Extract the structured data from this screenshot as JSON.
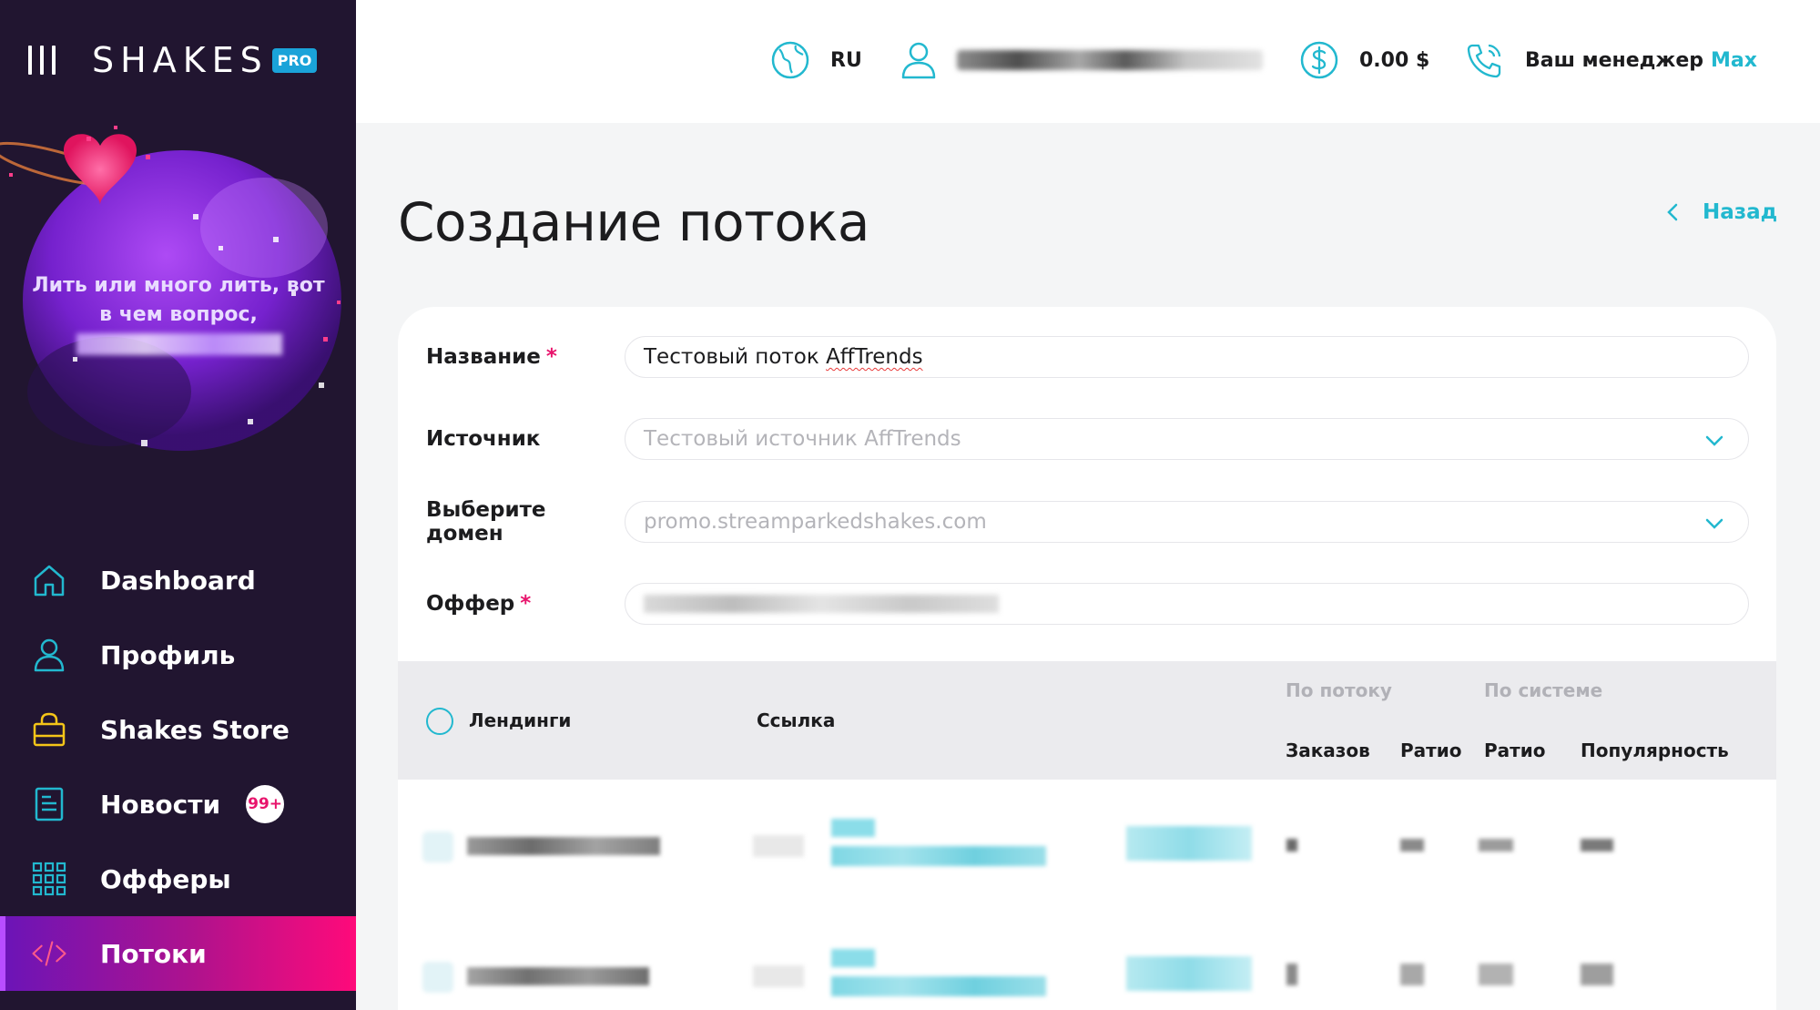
{
  "app": {
    "logo": "SHAKES",
    "logo_badge": "PRO"
  },
  "promo": {
    "text": "Лить или много лить, вот в чем вопрос,"
  },
  "sidebar": {
    "items": [
      {
        "label": "Dashboard",
        "icon": "home-icon"
      },
      {
        "label": "Профиль",
        "icon": "user-icon"
      },
      {
        "label": "Shakes Store",
        "icon": "shopping-bag-icon"
      },
      {
        "label": "Новости",
        "icon": "news-icon",
        "badge": "99+"
      },
      {
        "label": "Офферы",
        "icon": "grid-icon"
      },
      {
        "label": "Потоки",
        "icon": "code-icon",
        "active": true
      }
    ]
  },
  "header": {
    "language": "RU",
    "balance": "0.00 $",
    "manager_label": "Ваш менеджер",
    "manager_name": "Max"
  },
  "page": {
    "title": "Создание потока",
    "back_label": "Назад"
  },
  "form": {
    "name": {
      "label": "Название",
      "value": "Тестовый поток AffTrends",
      "value_plain": "Тестовый поток ",
      "value_flagged": "AffTrends"
    },
    "source": {
      "label": "Источник",
      "placeholder": "Тестовый источник AffTrends"
    },
    "domain": {
      "label": "Выберите домен",
      "placeholder": "promo.streamparkedshakes.com"
    },
    "offer": {
      "label": "Оффер"
    },
    "required_mark": "*"
  },
  "table": {
    "col_landings": "Лендинги",
    "col_link": "Ссылка",
    "group_stream": "По потоку",
    "group_system": "По системе",
    "col_orders": "Заказов",
    "col_ratio_stream": "Ратио",
    "col_ratio_system": "Ратио",
    "col_popularity": "Популярность"
  },
  "colors": {
    "accent": "#22b8cf",
    "sidebar_bg": "#211530",
    "active_gradient_start": "#6a14b8",
    "active_gradient_end": "#ff0a7a",
    "required": "#e8146c"
  }
}
